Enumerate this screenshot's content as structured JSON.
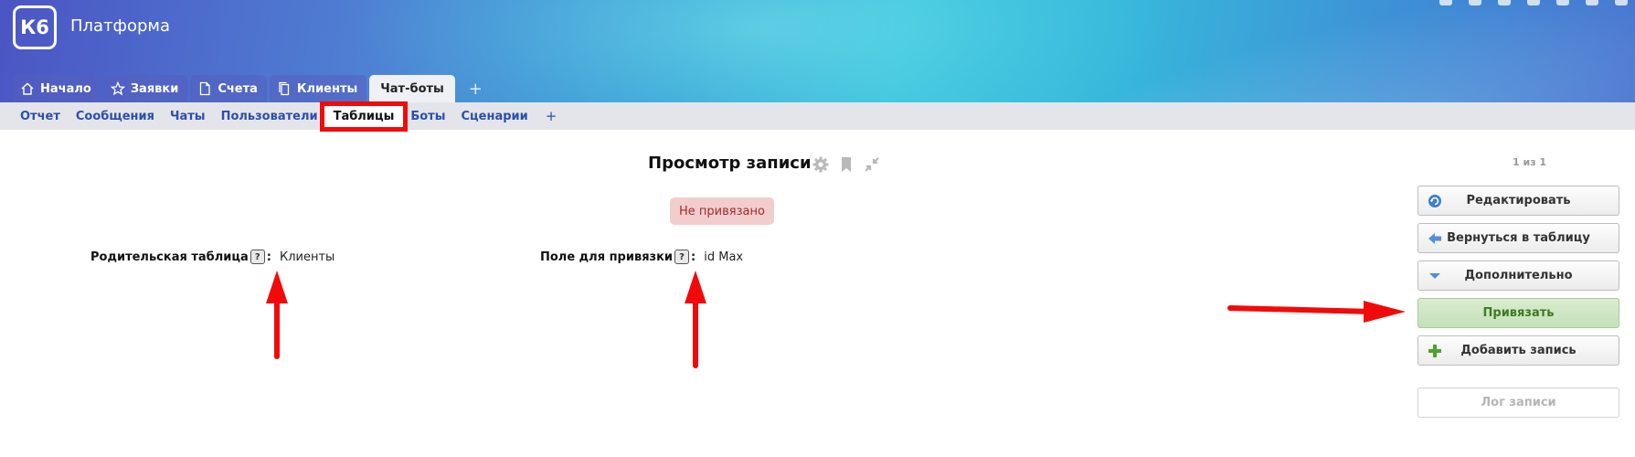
{
  "app": {
    "logo": "К6",
    "title": "Платформа"
  },
  "main_tabs": [
    {
      "label": "Начало",
      "icon": "home-icon"
    },
    {
      "label": "Заявки",
      "icon": "star-icon"
    },
    {
      "label": "Счета",
      "icon": "document-icon"
    },
    {
      "label": "Клиенты",
      "icon": "copy-icon"
    },
    {
      "label": "Чат-боты",
      "icon": "",
      "active": true
    }
  ],
  "main_tabs_add": "+",
  "subnav": [
    {
      "label": "Отчет"
    },
    {
      "label": "Сообщения"
    },
    {
      "label": "Чаты"
    },
    {
      "label": "Пользователи"
    },
    {
      "label": "Таблицы",
      "active": true
    },
    {
      "label": "Боты"
    },
    {
      "label": "Сценарии"
    }
  ],
  "subnav_add": "+",
  "page": {
    "title": "Просмотр записи",
    "status": "Не привязано",
    "help_mark": "?",
    "fields": [
      {
        "label": "Родительская таблица",
        "value": "Клиенты"
      },
      {
        "label": "Поле для привязки",
        "value": "id Max"
      }
    ]
  },
  "panel": {
    "counter": "1 из 1",
    "buttons": [
      {
        "label": "Редактировать",
        "icon": "refresh-icon"
      },
      {
        "label": "Вернуться в таблицу",
        "icon": "arrow-left-icon"
      },
      {
        "label": "Дополнительно",
        "icon": "triangle-down-icon"
      },
      {
        "label": "Привязать",
        "icon": ""
      },
      {
        "label": "Добавить запись",
        "icon": "plus-icon"
      }
    ],
    "log_button": "Лог записи"
  },
  "colors": {
    "annotation_red": "#f20a0a",
    "link_blue": "#2d4fa9",
    "status_bg": "#f2cdcd",
    "primary_green": "#3c7a22"
  }
}
